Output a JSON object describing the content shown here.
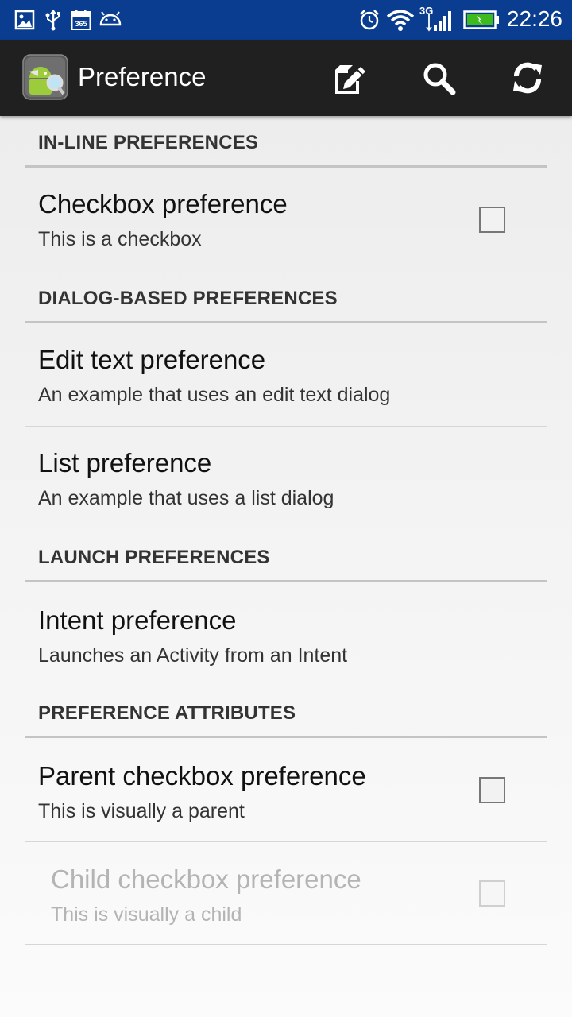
{
  "status_bar": {
    "time": "22:26",
    "network_label": "3G",
    "calendar_label": "365",
    "left_icons": [
      "image-icon",
      "usb-icon",
      "calendar-icon",
      "android-debug-icon"
    ],
    "right_icons": [
      "alarm-icon",
      "wifi-icon",
      "signal-icon",
      "battery-icon"
    ]
  },
  "action_bar": {
    "title": "Preference",
    "actions": [
      "edit-icon",
      "search-icon",
      "refresh-icon"
    ]
  },
  "sections": [
    {
      "header": "IN-LINE PREFERENCES"
    },
    {
      "header": "DIALOG-BASED PREFERENCES"
    },
    {
      "header": "LAUNCH PREFERENCES"
    },
    {
      "header": "PREFERENCE ATTRIBUTES"
    }
  ],
  "prefs": {
    "checkbox": {
      "title": "Checkbox preference",
      "summary": "This is a checkbox",
      "checked": false
    },
    "edit_text": {
      "title": "Edit text preference",
      "summary": "An example that uses an edit text dialog"
    },
    "list": {
      "title": "List preference",
      "summary": "An example that uses a list dialog"
    },
    "intent": {
      "title": "Intent preference",
      "summary": "Launches an Activity from an Intent"
    },
    "parent_checkbox": {
      "title": "Parent checkbox preference",
      "summary": "This is visually a parent",
      "checked": false
    },
    "child_checkbox": {
      "title": "Child checkbox preference",
      "summary": "This is visually a child",
      "checked": false,
      "enabled": false
    }
  },
  "colors": {
    "status_bar": "#0a3d8f",
    "action_bar": "#202020",
    "battery_fill": "#3dba1e"
  }
}
